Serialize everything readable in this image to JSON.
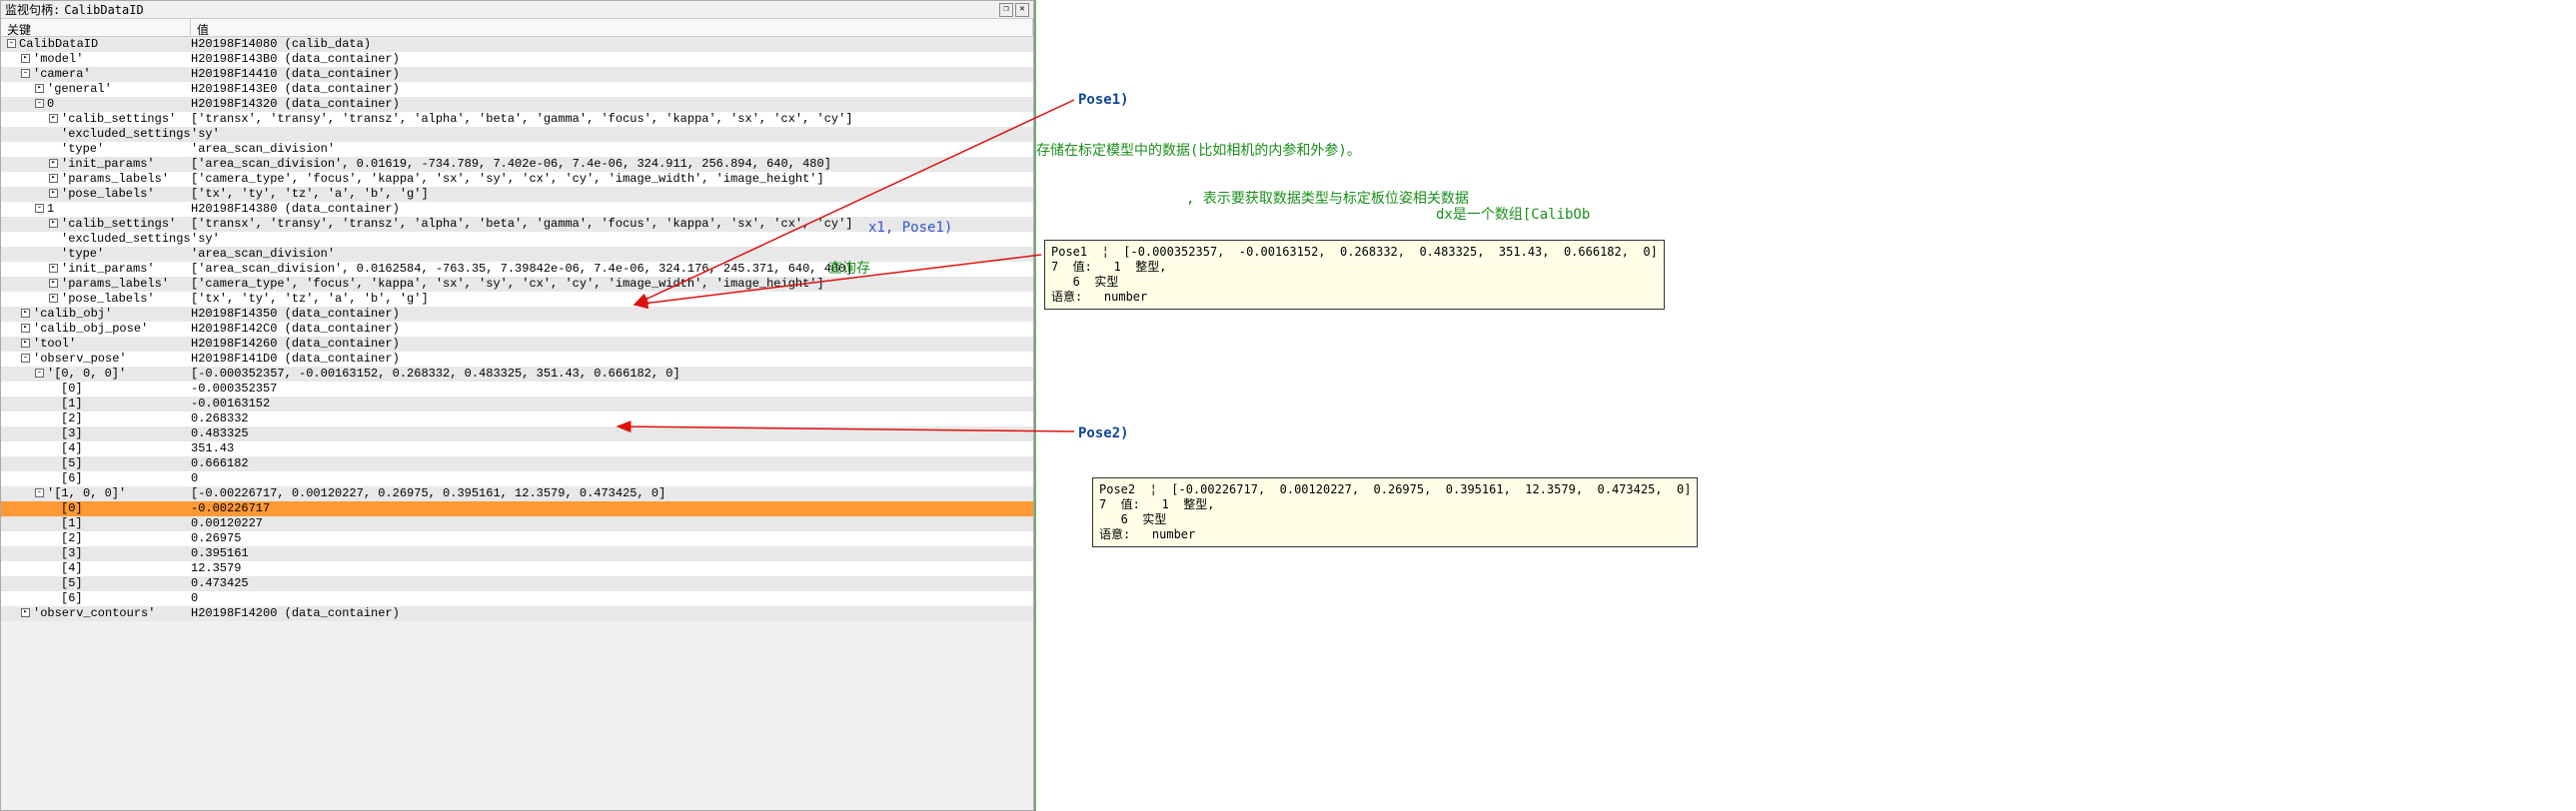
{
  "title": {
    "label": "监视句柄:",
    "value": "CalibDataID"
  },
  "headers": {
    "key": "关键",
    "val": "值"
  },
  "right": {
    "pose1_label": "Pose1)",
    "pose2_label": "Pose2)",
    "green1": "存储在标定模型中的数据(比如相机的内参和外参)。",
    "green2_mid": ", 表示要获取数据类型与标定板位姿相关数据",
    "green2_tail": "dx是一个数组[CalibOb",
    "blue_frag": "x1, Pose1)",
    "green3": "查询存",
    "tip1_l1": "Pose1  ¦  [-0.000352357,  -0.00163152,  0.268332,  0.483325,  351.43,  0.666182,  0]",
    "tip1_l2": "7  值:   1  整型,",
    "tip1_l3": "   6  实型",
    "tip1_l4": "语意:   number",
    "tip2_l1": "Pose2  ¦  [-0.00226717,  0.00120227,  0.26975,  0.395161,  12.3579,  0.473425,  0]",
    "tip2_l2": "7  值:   1  整型,",
    "tip2_l3": "   6  实型",
    "tip2_l4": "语意:   number"
  },
  "rows": [
    {
      "d": 0,
      "t": "-",
      "k": "CalibDataID",
      "v": "H20198F14080 (calib_data)"
    },
    {
      "d": 1,
      "t": ">",
      "k": "'model'",
      "v": "H20198F143B0 (data_container)"
    },
    {
      "d": 1,
      "t": "-",
      "k": "'camera'",
      "v": "H20198F14410 (data_container)"
    },
    {
      "d": 2,
      "t": ">",
      "k": "'general'",
      "v": "H20198F143E0 (data_container)"
    },
    {
      "d": 2,
      "t": "-",
      "k": "0",
      "v": "H20198F14320 (data_container)"
    },
    {
      "d": 3,
      "t": ">",
      "k": "'calib_settings'",
      "v": "['transx', 'transy', 'transz', 'alpha', 'beta', 'gamma', 'focus', 'kappa', 'sx', 'cx', 'cy']"
    },
    {
      "d": 3,
      "t": "",
      "k": "'excluded_settings'",
      "v": "'sy'"
    },
    {
      "d": 3,
      "t": "",
      "k": "'type'",
      "v": "'area_scan_division'"
    },
    {
      "d": 3,
      "t": ">",
      "k": "'init_params'",
      "v": "['area_scan_division', 0.01619, -734.789, 7.402e-06, 7.4e-06, 324.911, 256.894, 640, 480]"
    },
    {
      "d": 3,
      "t": ">",
      "k": "'params_labels'",
      "v": "['camera_type', 'focus', 'kappa', 'sx', 'sy', 'cx', 'cy', 'image_width', 'image_height']"
    },
    {
      "d": 3,
      "t": ">",
      "k": "'pose_labels'",
      "v": "['tx', 'ty', 'tz', 'a', 'b', 'g']"
    },
    {
      "d": 2,
      "t": "-",
      "k": "1",
      "v": "H20198F14380 (data_container)"
    },
    {
      "d": 3,
      "t": ">",
      "k": "'calib_settings'",
      "v": "['transx', 'transy', 'transz', 'alpha', 'beta', 'gamma', 'focus', 'kappa', 'sx', 'cx', 'cy']"
    },
    {
      "d": 3,
      "t": "",
      "k": "'excluded_settings'",
      "v": "'sy'"
    },
    {
      "d": 3,
      "t": "",
      "k": "'type'",
      "v": "'area_scan_division'"
    },
    {
      "d": 3,
      "t": ">",
      "k": "'init_params'",
      "v": "['area_scan_division', 0.0162584, -763.35, 7.39842e-06, 7.4e-06, 324.176, 245.371, 640, 480]"
    },
    {
      "d": 3,
      "t": ">",
      "k": "'params_labels'",
      "v": "['camera_type', 'focus', 'kappa', 'sx', 'sy', 'cx', 'cy', 'image_width', 'image_height']"
    },
    {
      "d": 3,
      "t": ">",
      "k": "'pose_labels'",
      "v": "['tx', 'ty', 'tz', 'a', 'b', 'g']"
    },
    {
      "d": 1,
      "t": ">",
      "k": "'calib_obj'",
      "v": "H20198F14350 (data_container)"
    },
    {
      "d": 1,
      "t": ">",
      "k": "'calib_obj_pose'",
      "v": "H20198F142C0 (data_container)"
    },
    {
      "d": 1,
      "t": ">",
      "k": "'tool'",
      "v": "H20198F14260 (data_container)"
    },
    {
      "d": 1,
      "t": "-",
      "k": "'observ_pose'",
      "v": "H20198F141D0 (data_container)"
    },
    {
      "d": 2,
      "t": "-",
      "k": "'[0, 0, 0]'",
      "v": "[-0.000352357, -0.00163152, 0.268332, 0.483325, 351.43, 0.666182, 0]"
    },
    {
      "d": 3,
      "t": "",
      "k": "[0]",
      "v": "-0.000352357"
    },
    {
      "d": 3,
      "t": "",
      "k": "[1]",
      "v": "-0.00163152"
    },
    {
      "d": 3,
      "t": "",
      "k": "[2]",
      "v": "0.268332"
    },
    {
      "d": 3,
      "t": "",
      "k": "[3]",
      "v": "0.483325"
    },
    {
      "d": 3,
      "t": "",
      "k": "[4]",
      "v": "351.43"
    },
    {
      "d": 3,
      "t": "",
      "k": "[5]",
      "v": "0.666182"
    },
    {
      "d": 3,
      "t": "",
      "k": "[6]",
      "v": "0"
    },
    {
      "d": 2,
      "t": "-",
      "k": "'[1, 0, 0]'",
      "v": "[-0.00226717, 0.00120227, 0.26975, 0.395161, 12.3579, 0.473425, 0]"
    },
    {
      "d": 3,
      "t": "",
      "k": "[0]",
      "v": "-0.00226717",
      "sel": true
    },
    {
      "d": 3,
      "t": "",
      "k": "[1]",
      "v": "0.00120227"
    },
    {
      "d": 3,
      "t": "",
      "k": "[2]",
      "v": "0.26975"
    },
    {
      "d": 3,
      "t": "",
      "k": "[3]",
      "v": "0.395161"
    },
    {
      "d": 3,
      "t": "",
      "k": "[4]",
      "v": "12.3579"
    },
    {
      "d": 3,
      "t": "",
      "k": "[5]",
      "v": "0.473425"
    },
    {
      "d": 3,
      "t": "",
      "k": "[6]",
      "v": "0"
    },
    {
      "d": 1,
      "t": ">",
      "k": "'observ_contours'",
      "v": "H20198F14200 (data_container)"
    }
  ]
}
